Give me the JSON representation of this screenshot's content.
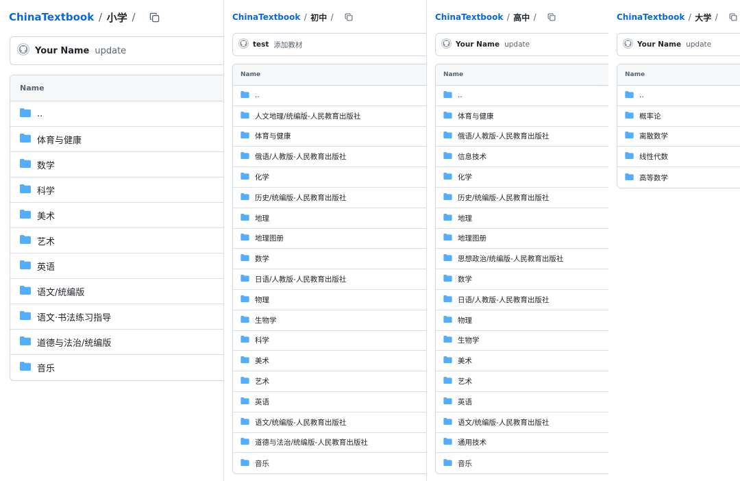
{
  "colors": {
    "link": "#0969da",
    "folder": "#54aeff",
    "border": "#d1d9e0",
    "header_bg": "#f6f8fa"
  },
  "icons": {
    "folder": "folder-icon",
    "copy": "copy-icon",
    "avatar": "github-avatar-icon"
  },
  "panels": [
    {
      "repo": "ChinaTextbook",
      "dir": "小学",
      "commit_author": "Your Name",
      "commit_message": "update",
      "column_header": "Name",
      "items": [
        "..",
        "体育与健康",
        "数学",
        "科学",
        "美术",
        "艺术",
        "英语",
        "语文/统编版",
        "语文·书法练习指导",
        "道德与法治/统编版",
        "音乐"
      ]
    },
    {
      "repo": "ChinaTextbook",
      "dir": "初中",
      "commit_author": "test",
      "commit_message": "添加教材",
      "column_header": "Name",
      "items": [
        "..",
        "人文地理/统编版-人民教育出版社",
        "体育与健康",
        "俄语/人教版-人民教育出版社",
        "化学",
        "历史/统编版-人民教育出版社",
        "地理",
        "地理图册",
        "数学",
        "日语/人教版-人民教育出版社",
        "物理",
        "生物学",
        "科学",
        "美术",
        "艺术",
        "英语",
        "语文/统编版-人民教育出版社",
        "道德与法治/统编版-人民教育出版社",
        "音乐"
      ]
    },
    {
      "repo": "ChinaTextbook",
      "dir": "高中",
      "commit_author": "Your Name",
      "commit_message": "update",
      "column_header": "Name",
      "items": [
        "..",
        "体育与健康",
        "俄语/人教版-人民教育出版社",
        "信息技术",
        "化学",
        "历史/统编版-人民教育出版社",
        "地理",
        "地理图册",
        "思想政治/统编版-人民教育出版社",
        "数学",
        "日语/人教版-人民教育出版社",
        "物理",
        "生物学",
        "美术",
        "艺术",
        "英语",
        "语文/统编版-人民教育出版社",
        "通用技术",
        "音乐"
      ]
    },
    {
      "repo": "ChinaTextbook",
      "dir": "大学",
      "commit_author": "Your Name",
      "commit_message": "update",
      "column_header": "Name",
      "items": [
        "..",
        "概率论",
        "离散数学",
        "线性代数",
        "高等数学"
      ]
    }
  ]
}
